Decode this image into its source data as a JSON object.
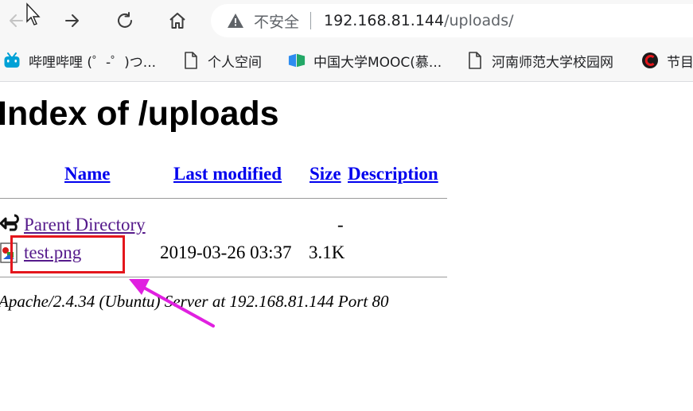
{
  "browser": {
    "security_label": "不安全",
    "url_host": "192.168.81.144",
    "url_path": "/uploads/",
    "bookmarks": [
      {
        "label": "哔哩哔哩 (゜-゜)つ...",
        "icon": "bilibili-icon"
      },
      {
        "label": "个人空间",
        "icon": "page-icon"
      },
      {
        "label": "中国大学MOOC(慕...",
        "icon": "mooc-icon"
      },
      {
        "label": "河南师范大学校园网",
        "icon": "page-icon"
      },
      {
        "label": "节目",
        "icon": "red-c-icon"
      }
    ]
  },
  "page": {
    "title": "Index of /uploads",
    "columns": [
      "Name",
      "Last modified",
      "Size",
      "Description"
    ],
    "rows": [
      {
        "name": "Parent Directory",
        "modified": "",
        "size": "-",
        "description": "",
        "icon": "back-icon"
      },
      {
        "name": "test.png",
        "modified": "2019-03-26 03:37",
        "size": "3.1K",
        "description": "",
        "icon": "image-icon"
      }
    ],
    "footer": "Apache/2.4.34 (Ubuntu) Server at 192.168.81.144 Port 80"
  },
  "annotation": {
    "color": "#e4161c",
    "arrow_color": "#e020e0"
  }
}
